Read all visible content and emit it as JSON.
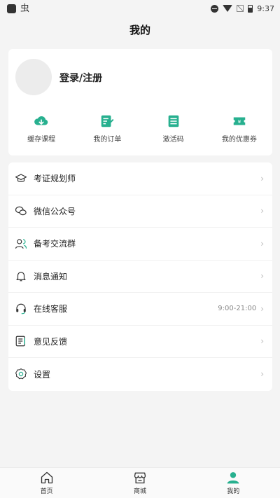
{
  "status_bar": {
    "time": "9:37",
    "notification_icon": "bug-icon"
  },
  "header": {
    "title": "我的"
  },
  "profile": {
    "login_label": "登录/注册"
  },
  "quick_actions": [
    {
      "label": "缓存课程",
      "icon": "cloud-download-icon"
    },
    {
      "label": "我的订单",
      "icon": "order-edit-icon"
    },
    {
      "label": "激活码",
      "icon": "document-icon"
    },
    {
      "label": "我的优惠券",
      "icon": "coupon-icon"
    }
  ],
  "menu": [
    {
      "label": "考证规划师",
      "icon": "graduation-cap-icon"
    },
    {
      "label": "微信公众号",
      "icon": "wechat-icon"
    },
    {
      "label": "备考交流群",
      "icon": "group-icon"
    },
    {
      "label": "消息通知",
      "icon": "bell-icon"
    },
    {
      "label": "在线客服",
      "icon": "headset-icon",
      "extra": "9:00-21:00"
    },
    {
      "label": "意见反馈",
      "icon": "feedback-icon"
    },
    {
      "label": "设置",
      "icon": "settings-icon"
    }
  ],
  "tabs": [
    {
      "label": "首页",
      "icon": "home-icon",
      "active": false
    },
    {
      "label": "商城",
      "icon": "store-icon",
      "active": false
    },
    {
      "label": "我的",
      "icon": "person-icon",
      "active": true
    }
  ],
  "colors": {
    "accent": "#27b08f",
    "background": "#f4f4f4",
    "card": "#ffffff"
  }
}
